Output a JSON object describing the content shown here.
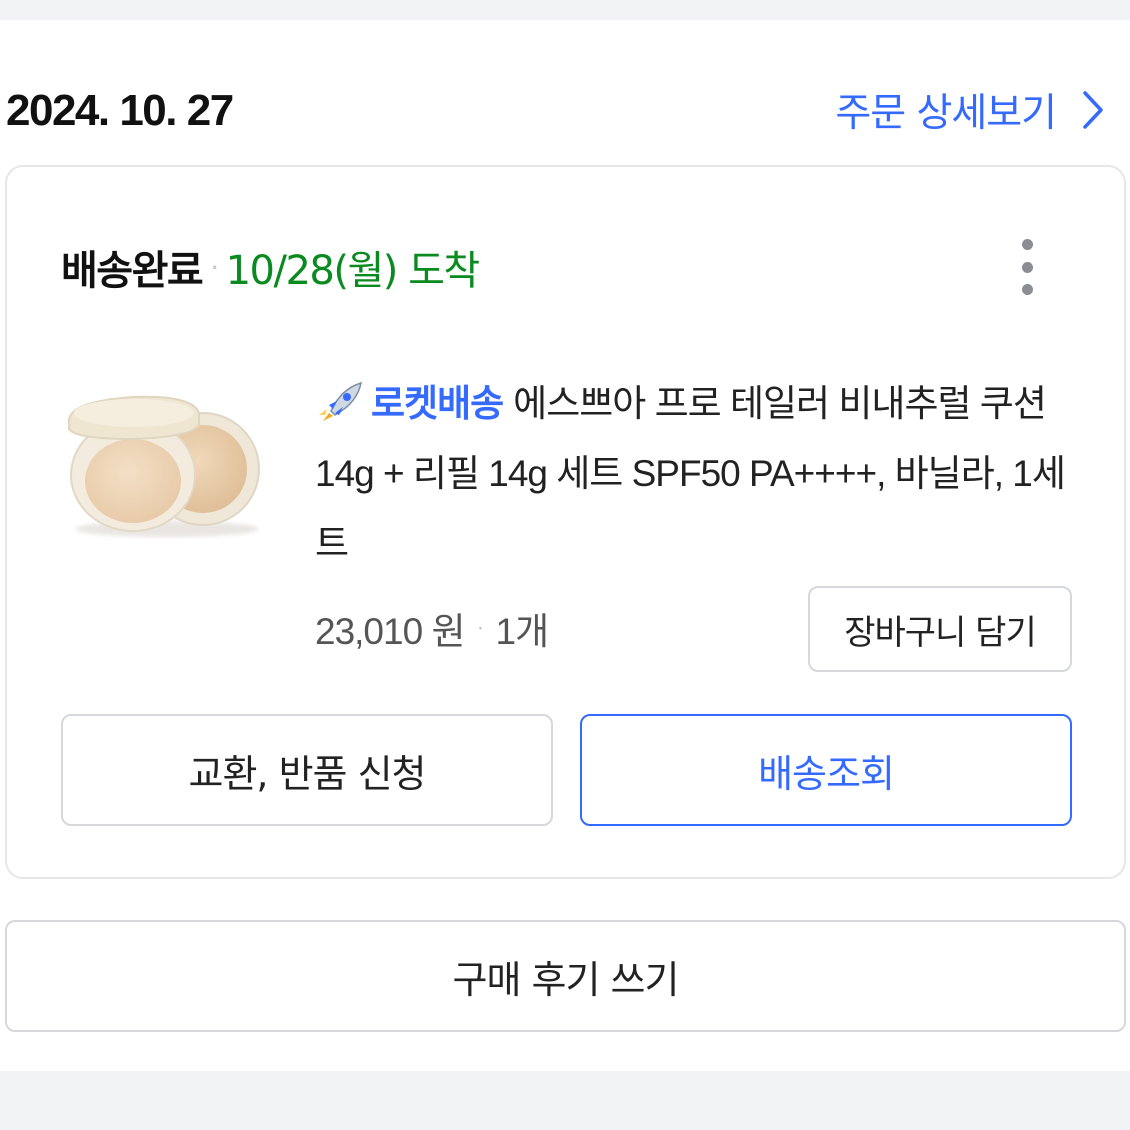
{
  "colors": {
    "accent_blue": "#346aff",
    "delivered_green": "#0a8a1f",
    "border_gray": "#d6d8dc",
    "background_band": "#f2f3f5"
  },
  "order": {
    "date": "2024. 10. 27",
    "detail_link_label": "주문 상세보기",
    "detail_link_icon": "chevron-right-icon"
  },
  "delivery": {
    "status": "배송완료",
    "separator": "·",
    "arrival": "10/28(월) 도착",
    "more_icon": "more-vertical-icon"
  },
  "product": {
    "image": "cushion-compact-image",
    "badge_icon": "rocket-icon",
    "badge_label": "로켓배송",
    "name": "에스쁘아 프로 테일러 비내추럴 쿠션 14g + 리필 14g 세트 SPF50 PA++++, 바닐라, 1세트",
    "price": "23,010 원",
    "separator": "·",
    "quantity": "1개"
  },
  "actions": {
    "add_to_cart": "장바구니 담기",
    "exchange_return": "교환, 반품 신청",
    "track_delivery": "배송조회",
    "write_review": "구매 후기 쓰기"
  }
}
